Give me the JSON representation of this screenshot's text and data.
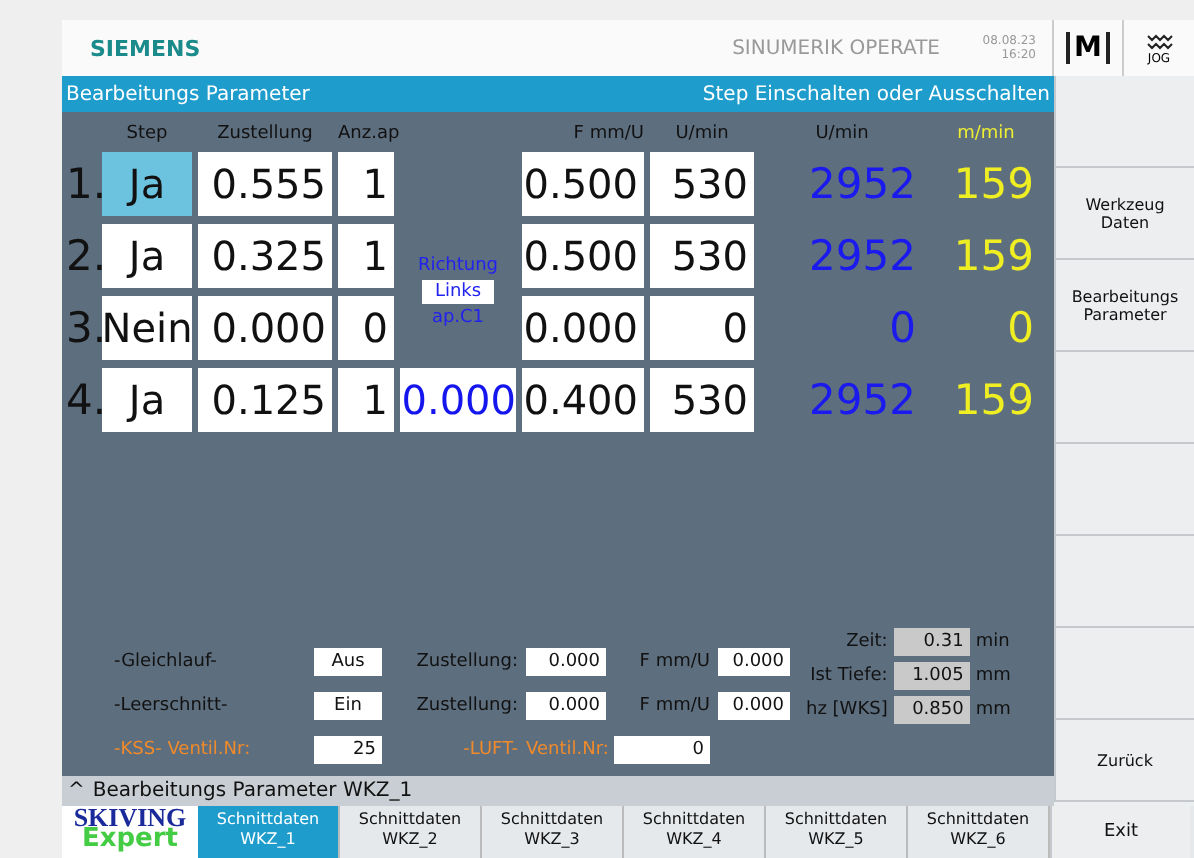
{
  "header": {
    "brand": "SIEMENS",
    "product": "SINUMERIK OPERATE",
    "date": "08.08.23",
    "time": "16:20",
    "mode_m": "M",
    "mode_jog": "JOG"
  },
  "title_bar": {
    "left": "Bearbeitungs Parameter",
    "right": "Step Einschalten oder Ausschalten"
  },
  "columns": {
    "step": "Step",
    "zustellung": "Zustellung",
    "anz": "Anz.ap",
    "f": "F mm/U",
    "umin": "U/min",
    "umin_calc": "U/min",
    "mmin": "m/min"
  },
  "richtung": {
    "label": "Richtung",
    "value": "Links",
    "axis": "ap.C1"
  },
  "rows": [
    {
      "number": "1.",
      "step": "Ja",
      "selected": true,
      "zustellung": "0.555",
      "anz": "1",
      "f": "0.500",
      "umin": "530",
      "umin_calc": "2952",
      "mmin": "159"
    },
    {
      "number": "2.",
      "step": "Ja",
      "selected": false,
      "zustellung": "0.325",
      "anz": "1",
      "f": "0.500",
      "umin": "530",
      "umin_calc": "2952",
      "mmin": "159"
    },
    {
      "number": "3.",
      "step": "Nein",
      "selected": false,
      "zustellung": "0.000",
      "anz": "0",
      "f": "0.000",
      "umin": "0",
      "umin_calc": "0",
      "mmin": "0"
    },
    {
      "number": "4.",
      "step": "Ja",
      "selected": false,
      "zustellung": "0.125",
      "anz": "1",
      "c1": "0.000",
      "f": "0.400",
      "umin": "530",
      "umin_calc": "2952",
      "mmin": "159"
    }
  ],
  "options": [
    {
      "label": "-Gleichlauf-",
      "value": "Aus",
      "zust_label": "Zustellung:",
      "zust": "0.000",
      "f_label": "F mm/U",
      "f": "0.000"
    },
    {
      "label": "-Leerschnitt-",
      "value": "Ein",
      "zust_label": "Zustellung:",
      "zust": "0.000",
      "f_label": "F mm/U",
      "f": "0.000"
    }
  ],
  "coolant": {
    "kss": "-KSS-",
    "kss_label": "Ventil.Nr:",
    "kss_value": "25",
    "luft": "-LUFT-",
    "luft_label": "Ventil.Nr:",
    "luft_value": "0"
  },
  "info": [
    {
      "label": "Zeit:",
      "value": "0.31",
      "unit": "min"
    },
    {
      "label": "Ist Tiefe:",
      "value": "1.005",
      "unit": "mm"
    },
    {
      "label": "hz [WKS]",
      "value": "0.850",
      "unit": "mm"
    }
  ],
  "status_bar": {
    "icon": "^",
    "text": "Bearbeitungs Parameter WKZ_1"
  },
  "logo": {
    "line1": "SKIVING",
    "line2": "Expert"
  },
  "tabs": [
    {
      "line1": "Schnittdaten",
      "line2": "WKZ_1",
      "selected": true
    },
    {
      "line1": "Schnittdaten",
      "line2": "WKZ_2",
      "selected": false
    },
    {
      "line1": "Schnittdaten",
      "line2": "WKZ_3",
      "selected": false
    },
    {
      "line1": "Schnittdaten",
      "line2": "WKZ_4",
      "selected": false
    },
    {
      "line1": "Schnittdaten",
      "line2": "WKZ_5",
      "selected": false
    },
    {
      "line1": "Schnittdaten",
      "line2": "WKZ_6",
      "selected": false
    }
  ],
  "softkeys": [
    {
      "kind": "blank"
    },
    {
      "kind": "key",
      "label": "Werkzeug\nDaten"
    },
    {
      "kind": "key",
      "label": "Bearbeitungs\nParameter"
    },
    {
      "kind": "blank"
    },
    {
      "kind": "blank"
    },
    {
      "kind": "blank"
    },
    {
      "kind": "blank"
    },
    {
      "kind": "tall",
      "label": "Zurück"
    }
  ],
  "exit": "Exit"
}
